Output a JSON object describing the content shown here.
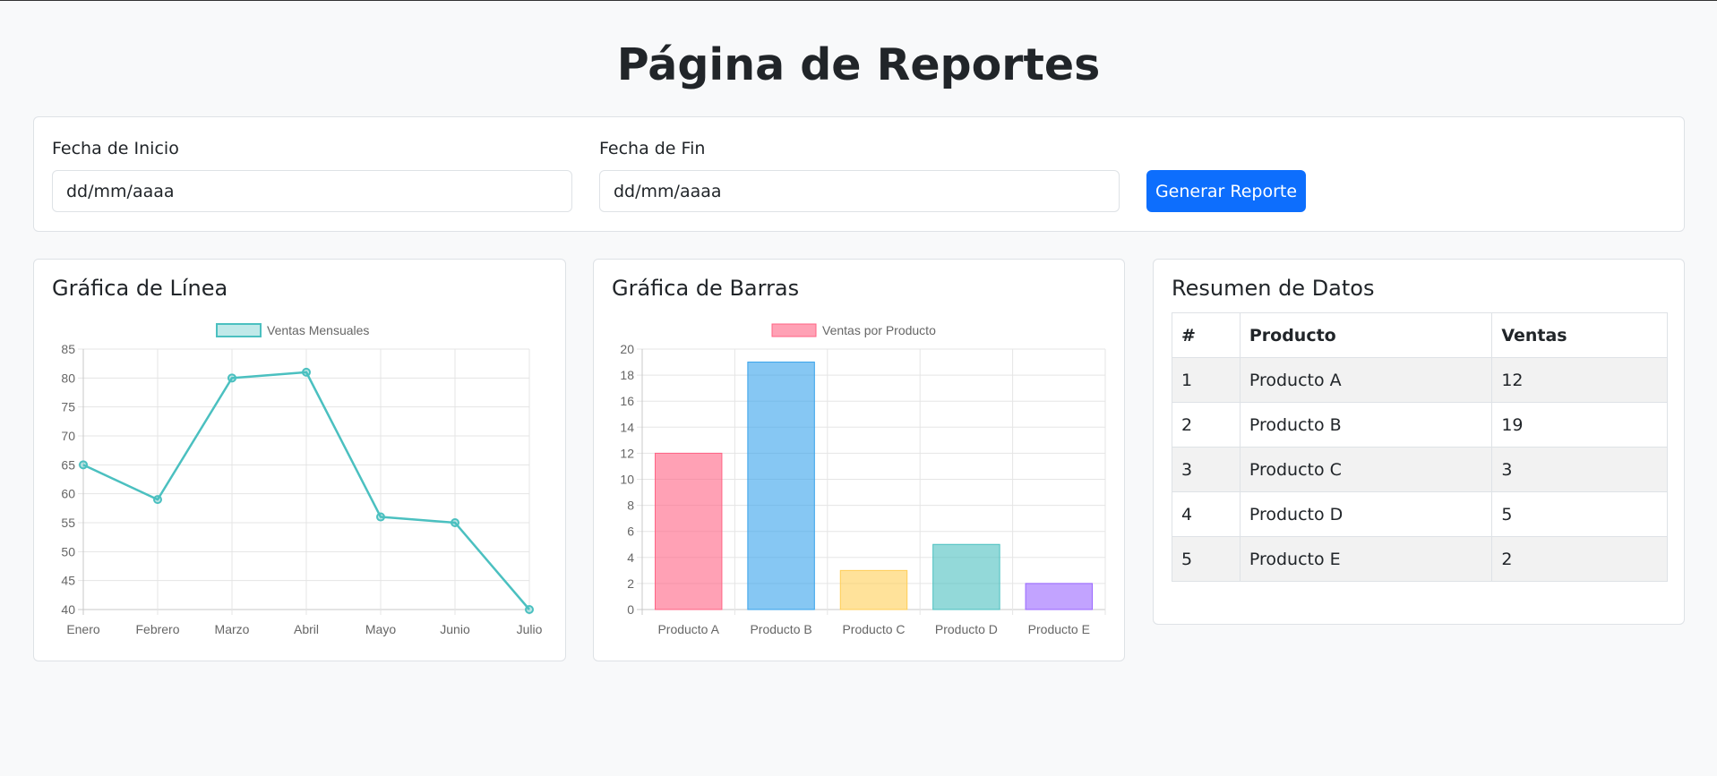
{
  "page": {
    "title": "Página de Reportes"
  },
  "filters": {
    "start_label": "Fecha de Inicio",
    "start_placeholder": "dd/mm/aaaa",
    "end_label": "Fecha de Fin",
    "end_placeholder": "dd/mm/aaaa",
    "button_label": "Generar Reporte",
    "button_color": "#0d6efd"
  },
  "line_card": {
    "title": "Gráfica de Línea"
  },
  "bar_card": {
    "title": "Gráfica de Barras"
  },
  "table_card": {
    "title": "Resumen de Datos",
    "headers": [
      "#",
      "Producto",
      "Ventas"
    ],
    "rows": [
      [
        "1",
        "Producto A",
        "12"
      ],
      [
        "2",
        "Producto B",
        "19"
      ],
      [
        "3",
        "Producto C",
        "3"
      ],
      [
        "4",
        "Producto D",
        "5"
      ],
      [
        "5",
        "Producto E",
        "2"
      ]
    ]
  },
  "chart_data": [
    {
      "type": "line",
      "categories": [
        "Enero",
        "Febrero",
        "Marzo",
        "Abril",
        "Mayo",
        "Junio",
        "Julio"
      ],
      "series": [
        {
          "name": "Ventas Mensuales",
          "values": [
            65,
            59,
            80,
            81,
            56,
            55,
            40
          ],
          "color": "#4bc0c0"
        }
      ],
      "ylim": [
        40,
        85
      ],
      "yticks": [
        40,
        45,
        50,
        55,
        60,
        65,
        70,
        75,
        80,
        85
      ],
      "grid": true,
      "legend": "top-center"
    },
    {
      "type": "bar",
      "categories": [
        "Producto A",
        "Producto B",
        "Producto C",
        "Producto D",
        "Producto E"
      ],
      "series": [
        {
          "name": "Ventas por Producto",
          "values": [
            12,
            19,
            3,
            5,
            2
          ]
        }
      ],
      "colors": [
        "#ff6384",
        "#36a2eb",
        "#ffce56",
        "#4bc0c0",
        "#9966ff"
      ],
      "ylim": [
        0,
        20
      ],
      "yticks": [
        0,
        2,
        4,
        6,
        8,
        10,
        12,
        14,
        16,
        18,
        20
      ],
      "grid": true,
      "legend": "top-center"
    }
  ]
}
